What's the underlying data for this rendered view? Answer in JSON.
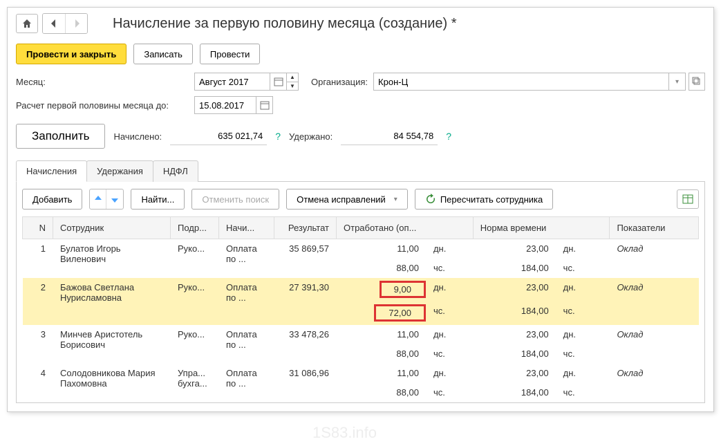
{
  "window": {
    "title": "Начисление за первую половину месяца (создание) *"
  },
  "buttons": {
    "post_close": "Провести и закрыть",
    "save": "Записать",
    "post": "Провести",
    "fill": "Заполнить",
    "add": "Добавить",
    "find": "Найти...",
    "cancel_search": "Отменить поиск",
    "cancel_corrections": "Отмена исправлений",
    "recalculate": "Пересчитать сотрудника"
  },
  "fields": {
    "month_label": "Месяц:",
    "month_value": "Август 2017",
    "org_label": "Организация:",
    "org_value": "Крон-Ц",
    "calc_until_label": "Расчет первой половины месяца до:",
    "calc_until_value": "15.08.2017",
    "accrued_label": "Начислено:",
    "accrued_value": "635 021,74",
    "withheld_label": "Удержано:",
    "withheld_value": "84 554,78"
  },
  "tabs": {
    "accruals": "Начисления",
    "deductions": "Удержания",
    "ndfl": "НДФЛ"
  },
  "table": {
    "headers": {
      "n": "N",
      "employee": "Сотрудник",
      "dept": "Подр...",
      "accrual": "Начи...",
      "result": "Результат",
      "worked": "Отработано (оп...",
      "norm": "Норма времени",
      "indicators": "Показатели"
    },
    "rows": [
      {
        "n": "1",
        "employee": "Булатов Игорь Виленович",
        "dept": "Руко...",
        "accrual": "Оплата по ...",
        "result": "35 869,57",
        "worked_days": "11,00",
        "worked_days_u": "дн.",
        "worked_hours": "88,00",
        "worked_hours_u": "чс.",
        "norm_days": "23,00",
        "norm_days_u": "дн.",
        "norm_hours": "184,00",
        "norm_hours_u": "чс.",
        "indicator": "Оклад",
        "highlighted": false
      },
      {
        "n": "2",
        "employee": "Бажова Светлана Нурисламовна",
        "dept": "Руко...",
        "accrual": "Оплата по ...",
        "result": "27 391,30",
        "worked_days": "9,00",
        "worked_days_u": "дн.",
        "worked_hours": "72,00",
        "worked_hours_u": "чс.",
        "norm_days": "23,00",
        "norm_days_u": "дн.",
        "norm_hours": "184,00",
        "norm_hours_u": "чс.",
        "indicator": "Оклад",
        "highlighted": true
      },
      {
        "n": "3",
        "employee": "Минчев Аристотель Борисович",
        "dept": "Руко...",
        "accrual": "Оплата по ...",
        "result": "33 478,26",
        "worked_days": "11,00",
        "worked_days_u": "дн.",
        "worked_hours": "88,00",
        "worked_hours_u": "чс.",
        "norm_days": "23,00",
        "norm_days_u": "дн.",
        "norm_hours": "184,00",
        "norm_hours_u": "чс.",
        "indicator": "Оклад",
        "highlighted": false
      },
      {
        "n": "4",
        "employee": "Солодовникова Мария Пахомовна",
        "dept": "Упра... бухга...",
        "accrual": "Оплата по ...",
        "result": "31 086,96",
        "worked_days": "11,00",
        "worked_days_u": "дн.",
        "worked_hours": "88,00",
        "worked_hours_u": "чс.",
        "norm_days": "23,00",
        "norm_days_u": "дн.",
        "norm_hours": "184,00",
        "norm_hours_u": "чс.",
        "indicator": "Оклад",
        "highlighted": false
      }
    ]
  },
  "watermark": "1S83.info"
}
